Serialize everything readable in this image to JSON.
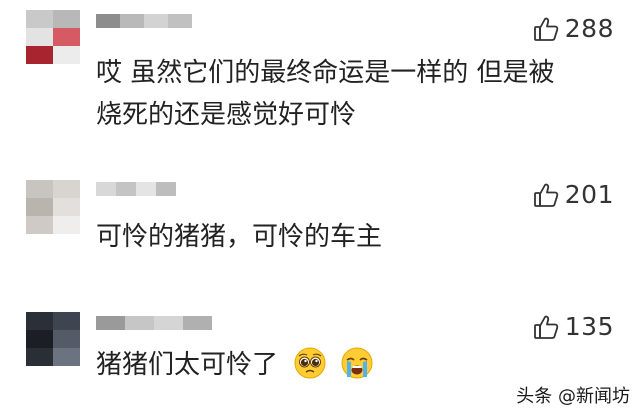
{
  "comments": [
    {
      "likes": "288",
      "text_lines": [
        "哎 虽然它们的最终命运是一样的 但是被",
        "烧死的还是感觉好可怜"
      ],
      "avatar_colors": [
        "#c9c9c9",
        "#b8b8b8",
        "#e3e3e3",
        "#d65a63",
        "#a8252f",
        "#ececec"
      ],
      "name_colors": [
        "#8d8d8d",
        "#b9b9b9",
        "#d3d3d3",
        "#c1c1c1"
      ]
    },
    {
      "likes": "201",
      "text_lines": [
        "可怜的猪猪，可怜的车主"
      ],
      "avatar_colors": [
        "#c8c4bf",
        "#d8d5d1",
        "#b9b4ae",
        "#e2dfdc",
        "#cfcac5",
        "#f0eeec"
      ],
      "name_colors": [
        "#d8d8d8",
        "#c4c4c4",
        "#e4e4e4",
        "#bdbdbd"
      ]
    },
    {
      "likes": "135",
      "text_lines": [
        "猪猪们太可怜了"
      ],
      "emojis": [
        "pleading-face-emoji",
        "loudly-crying-face-emoji"
      ],
      "avatar_colors": [
        "#2b2f38",
        "#3f4550",
        "#1b1e24",
        "#545b66",
        "#2a2e35",
        "#6b7280"
      ],
      "name_colors": [
        "#9a9a9a",
        "#c6c6c6",
        "#d5d5d5",
        "#b0b0b0"
      ]
    }
  ],
  "icons": {
    "like": "thumbs-up-icon"
  },
  "watermark": "头条 @新闻坊",
  "colors": {
    "text": "#222222",
    "like": "#333333",
    "background": "#ffffff"
  }
}
